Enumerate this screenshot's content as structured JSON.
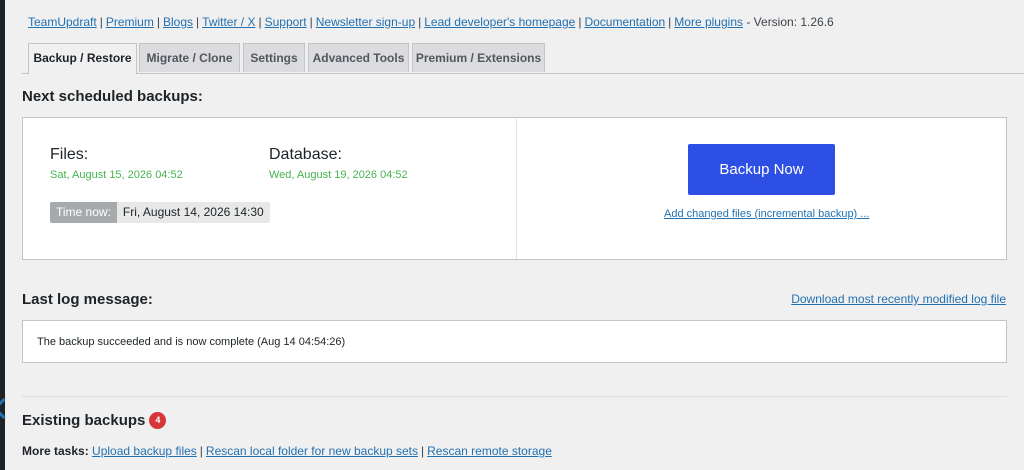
{
  "topnav": {
    "links": [
      "TeamUpdraft",
      "Premium",
      "Blogs",
      "Twitter / X",
      "Support",
      "Newsletter sign-up",
      "Lead developer's homepage",
      "Documentation",
      "More plugins"
    ],
    "separator": "|",
    "version": "- Version: 1.26.6"
  },
  "tabs": [
    "Backup / Restore",
    "Migrate / Clone",
    "Settings",
    "Advanced Tools",
    "Premium / Extensions"
  ],
  "active_tab": "Backup / Restore",
  "schedule": {
    "title": "Next scheduled backups:",
    "files_label": "Files:",
    "files_date": "Sat, August 15, 2026 04:52",
    "database_label": "Database:",
    "database_date": "Wed, August 19, 2026 04:52",
    "time_now_label": "Time now:",
    "time_now_value": "Fri, August 14, 2026 14:30",
    "backup_button": "Backup Now",
    "incremental_link": "Add changed files (incremental backup) ..."
  },
  "log": {
    "title": "Last log message:",
    "download_link": "Download most recently modified log file",
    "message": "The backup succeeded and is now complete (Aug 14 04:54:26)"
  },
  "existing": {
    "title": "Existing backups",
    "count": "4",
    "more_tasks_label": "More tasks:",
    "tasks": [
      "Upload backup files",
      "Rescan local folder for new backup sets",
      "Rescan remote storage"
    ]
  },
  "colors": {
    "accent_button": "#2e4fe3",
    "link": "#2271b1",
    "success_text": "#46b450",
    "badge": "#d63638"
  }
}
